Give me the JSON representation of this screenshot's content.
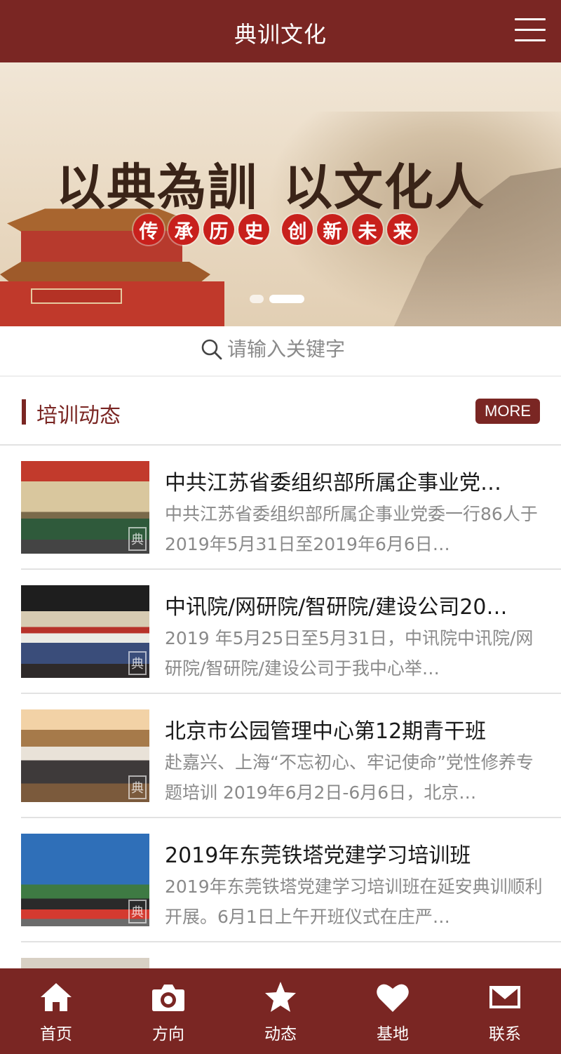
{
  "header": {
    "title": "典训文化",
    "menu_icon": "hamburger-menu-icon"
  },
  "banner": {
    "slogan_left": "以典為訓",
    "slogan_right": "以文化人",
    "subline_1": [
      "传",
      "承",
      "历",
      "史"
    ],
    "subline_2": [
      "创",
      "新",
      "未",
      "来"
    ],
    "active_slide": 2,
    "slide_count": 2
  },
  "search": {
    "placeholder": "请输入关键字",
    "icon": "search-icon"
  },
  "section": {
    "title": "培训动态",
    "more_label": "MORE"
  },
  "news": [
    {
      "title": "中共江苏省委组织部所属企事业党…",
      "desc": "中共江苏省委组织部所属企事业党委一行86人于2019年5月31日至2019年6月6日…"
    },
    {
      "title": "中讯院/网研院/智研院/建设公司20…",
      "desc": "2019 年5月25日至5月31日，中讯院中讯院/网研院/智研院/建设公司于我中心举…"
    },
    {
      "title": "北京市公园管理中心第12期青干班",
      "desc": "赴嘉兴、上海“不忘初心、牢记使命”党性修养专题培训 2019年6月2日-6月6日，北京…"
    },
    {
      "title": "2019年东莞铁塔党建学习培训班",
      "desc": "2019年东莞铁塔党建学习培训班在延安典训顺利开展。6月1日上午开班仪式在庄严…"
    },
    {
      "title": "",
      "desc": ""
    }
  ],
  "thumb_stamp": "典",
  "tabbar": [
    {
      "label": "首页",
      "icon": "home-icon"
    },
    {
      "label": "方向",
      "icon": "camera-icon"
    },
    {
      "label": "动态",
      "icon": "star-icon"
    },
    {
      "label": "基地",
      "icon": "heart-icon"
    },
    {
      "label": "联系",
      "icon": "mail-icon"
    }
  ],
  "colors": {
    "brand": "#7a2623",
    "seal_red": "#c8201c",
    "muted_text": "#8a8a8a"
  }
}
